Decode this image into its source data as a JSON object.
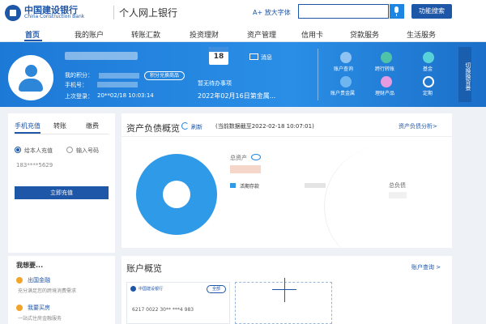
{
  "header": {
    "bank_name_cn": "中国建设银行",
    "bank_name_en": "China Construction Bank",
    "site_title": "个人网上银行",
    "font_size_label": "A+ 放大字体",
    "search_placeholder": "",
    "func_search_label": "功能搜索",
    "icons": [
      "bank-logo-icon",
      "microphone-icon"
    ]
  },
  "nav": {
    "items": [
      {
        "label": "首页",
        "active": true
      },
      {
        "label": "我的账户"
      },
      {
        "label": "转账汇款"
      },
      {
        "label": "投资理财"
      },
      {
        "label": "资产管理"
      },
      {
        "label": "信用卡"
      },
      {
        "label": "贷款服务"
      },
      {
        "label": "生活服务"
      }
    ]
  },
  "user": {
    "points_label": "我的积分：",
    "points_value": "--",
    "phone_label": "手机号：",
    "last_login_label": "上次登录：",
    "last_login_value": "20**02/18 10:03:14",
    "exchange_label": "积分兑换商品"
  },
  "todo": {
    "calendar_day": "18",
    "message_label": "消息",
    "no_todo": "暂无待办事项",
    "date_line": "2022年02月16日第金属..."
  },
  "quick_actions": [
    {
      "label": "账户查询",
      "icon": "account-query-icon"
    },
    {
      "label": "跨行转账",
      "icon": "transfer-icon"
    },
    {
      "label": "基金",
      "icon": "fund-icon"
    },
    {
      "label": "账户贵金属",
      "icon": "precious-metal-icon"
    },
    {
      "label": "理财产品",
      "icon": "wealth-icon"
    },
    {
      "label": "定期",
      "icon": "fixed-deposit-icon"
    }
  ],
  "switch_theme": "切换换背景",
  "recharge": {
    "tabs": [
      "手机充值",
      "转账",
      "缴费"
    ],
    "radio_self": "给本人充值",
    "radio_input": "输入号码",
    "phone": "183****5629",
    "button": "立即充值"
  },
  "assets": {
    "title": "资产负债概览",
    "refresh": "刷新",
    "data_time": "(当前数据截至2022-02-18 10:07:01)",
    "analysis_link": "资产负债分析>",
    "total_assets_label": "总资产",
    "legend_deposit": "活期存款",
    "total_liab_label": "总负债",
    "colors": {
      "donut": "#2f9ae8"
    }
  },
  "wants": {
    "title": "我想要...",
    "items": [
      {
        "label": "出国金融",
        "desc": "充分满足您的跨境消费需求"
      },
      {
        "label": "我要买房",
        "desc": "一站式住房金融服务"
      }
    ]
  },
  "accounts": {
    "title": "账户概览",
    "query_link": "账户查询 >",
    "card_bank": "中国建设银行",
    "card_tag": "全部",
    "card_number": "6217 0022 30** ***4 983"
  }
}
